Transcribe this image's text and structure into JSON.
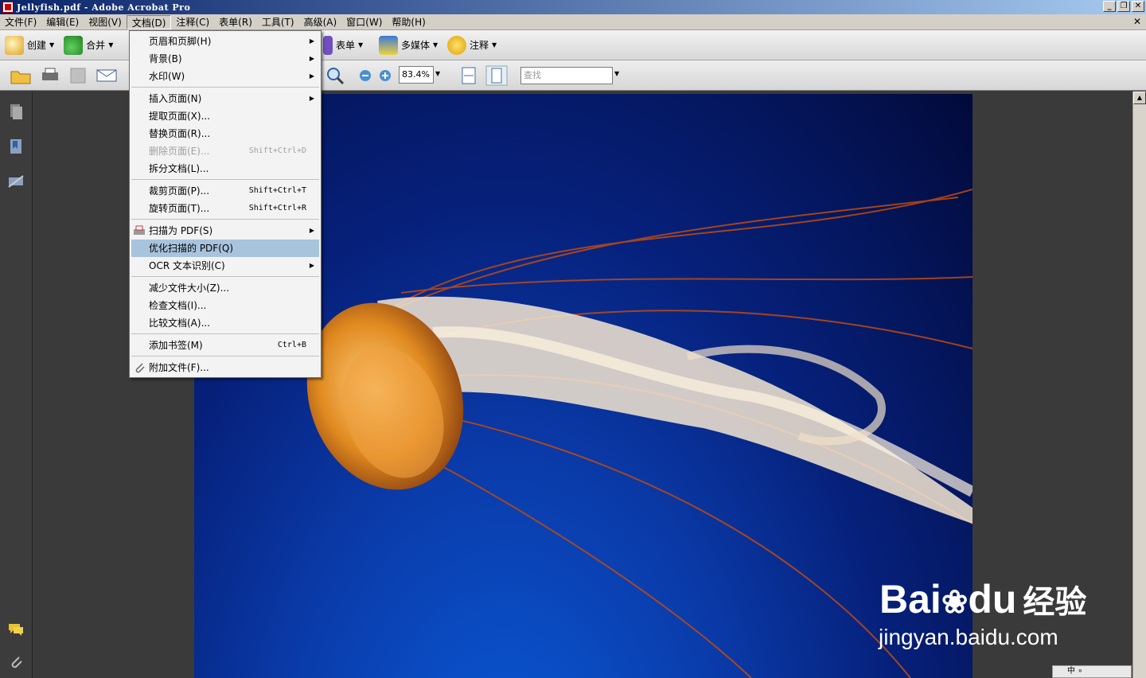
{
  "window": {
    "title": "Jellyfish.pdf - Adobe Acrobat Pro",
    "controls": [
      "_",
      "❐",
      "✕"
    ]
  },
  "menubar": {
    "items": [
      {
        "label": "文件(F)"
      },
      {
        "label": "编辑(E)"
      },
      {
        "label": "视图(V)"
      },
      {
        "label": "文档(D)"
      },
      {
        "label": "注释(C)"
      },
      {
        "label": "表单(R)"
      },
      {
        "label": "工具(T)"
      },
      {
        "label": "高级(A)"
      },
      {
        "label": "窗口(W)"
      },
      {
        "label": "帮助(H)"
      }
    ],
    "close": "✕"
  },
  "toolbar1": {
    "create": "创建",
    "combine": "合并",
    "forms": "表单",
    "multimedia": "多媒体",
    "comment": "注释"
  },
  "toolbar2": {
    "zoom": "83.4%",
    "search_placeholder": "查找"
  },
  "document_menu": {
    "items": [
      {
        "label": "页眉和页脚(H)",
        "submenu": true
      },
      {
        "label": "背景(B)",
        "submenu": true
      },
      {
        "label": "水印(W)",
        "submenu": true
      },
      {
        "label": "插入页面(N)",
        "submenu": true
      },
      {
        "label": "提取页面(X)..."
      },
      {
        "label": "替换页面(R)..."
      },
      {
        "label": "删除页面(E)...",
        "shortcut": "Shift+Ctrl+D",
        "disabled": true
      },
      {
        "label": "拆分文档(L)..."
      },
      {
        "label": "裁剪页面(P)...",
        "shortcut": "Shift+Ctrl+T"
      },
      {
        "label": "旋转页面(T)...",
        "shortcut": "Shift+Ctrl+R"
      },
      {
        "label": "扫描为 PDF(S)",
        "submenu": true
      },
      {
        "label": "优化扫描的 PDF(Q)",
        "highlighted": true
      },
      {
        "label": "OCR 文本识别(C)",
        "submenu": true
      },
      {
        "label": "减少文件大小(Z)..."
      },
      {
        "label": "检查文档(I)..."
      },
      {
        "label": "比较文档(A)..."
      },
      {
        "label": "添加书签(M)",
        "shortcut": "Ctrl+B"
      },
      {
        "label": "附加文件(F)..."
      }
    ]
  },
  "watermark": {
    "brand": "Bai",
    "brand_suffix": "du",
    "brand_cn": "经验",
    "url": "jingyan.baidu.com"
  },
  "ime": {
    "text": "中 ∘"
  },
  "colors": {
    "menu_highlight": "#a8c4dc",
    "titlebar": "#0a246a"
  }
}
